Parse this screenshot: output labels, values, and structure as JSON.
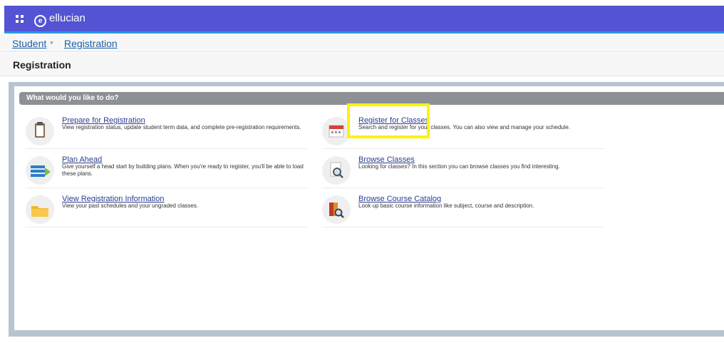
{
  "app": {
    "brand": "ellucian"
  },
  "breadcrumb": {
    "items": [
      "Student",
      "Registration"
    ],
    "separator": "•"
  },
  "page": {
    "title": "Registration"
  },
  "panel": {
    "header": "What would you like to do?"
  },
  "tiles": [
    {
      "title": "Prepare for Registration",
      "desc": "View registration status, update student term data, and complete pre-registration requirements.",
      "icon": "clipboard-icon"
    },
    {
      "title": "Register for Classes",
      "desc": "Search and register for your classes. You can also view and manage your schedule.",
      "icon": "calendar-icon"
    },
    {
      "title": "Plan Ahead",
      "desc": "Give yourself a head start by building plans. When you're ready to register, you'll be able to load these plans.",
      "icon": "plan-icon"
    },
    {
      "title": "Browse Classes",
      "desc": "Looking for classes? In this section you can browse classes you find interesting.",
      "icon": "magnifier-icon"
    },
    {
      "title": "View Registration Information",
      "desc": "View your past schedules and your ungraded classes.",
      "icon": "folder-icon"
    },
    {
      "title": "Browse Course Catalog",
      "desc": "Look up basic course information like subject, course and description.",
      "icon": "catalog-icon"
    }
  ],
  "colors": {
    "topbar": "#5353d4",
    "accent_line": "#2f95e0",
    "highlight": "#fff200",
    "link": "#2a3f8f"
  }
}
